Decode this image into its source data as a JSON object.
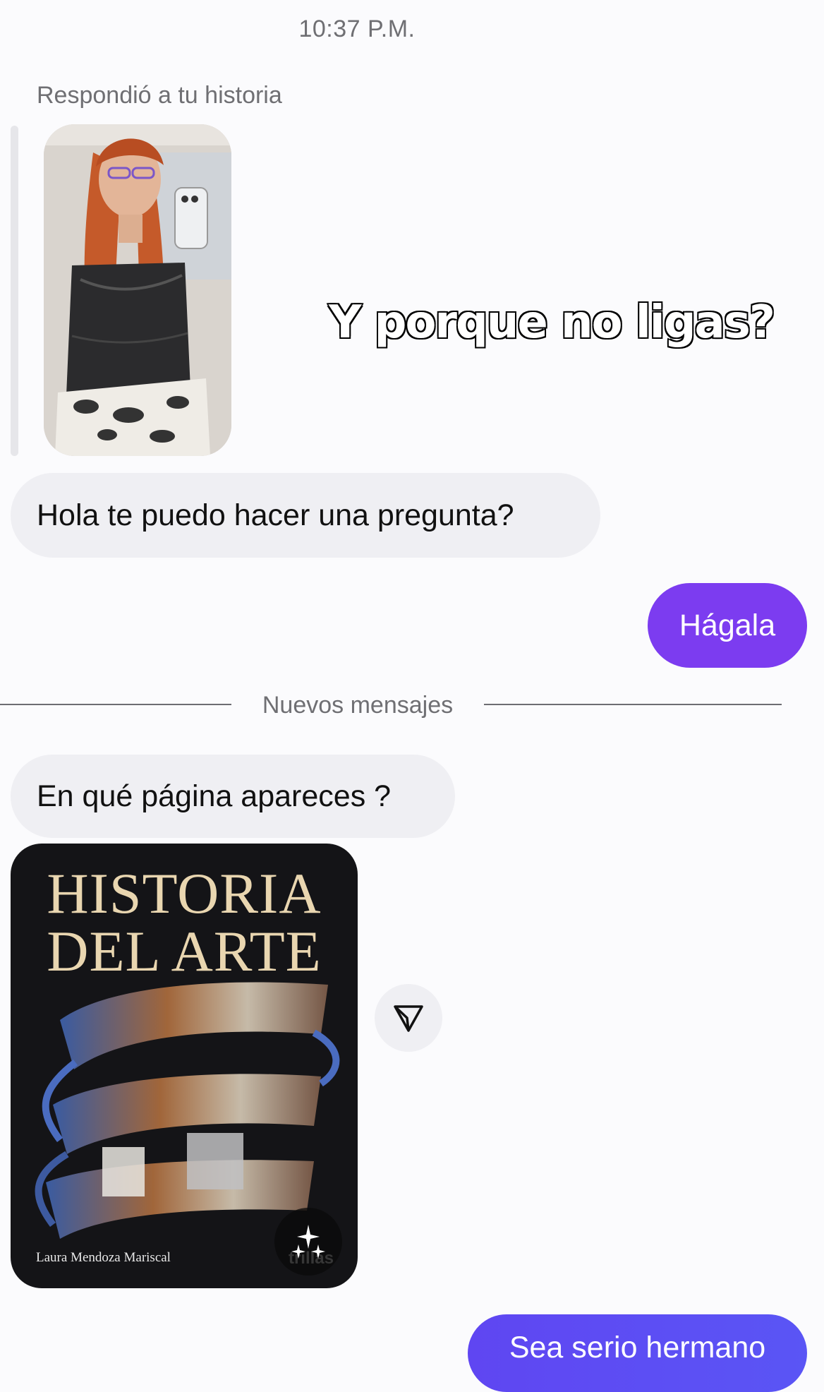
{
  "conversation": {
    "timestamp": "10:37 P.M.",
    "story_reply": {
      "caption": "Respondió a tu historia",
      "overlay_text": "Y porque no ligas?"
    },
    "messages": [
      {
        "id": "m1",
        "direction": "incoming",
        "text": "Hola te puedo hacer una pregunta?"
      },
      {
        "id": "m2",
        "direction": "outgoing",
        "text": "Hágala"
      },
      {
        "id": "m3",
        "direction": "incoming",
        "text": "En qué página apareces ?"
      },
      {
        "id": "m5",
        "direction": "outgoing",
        "text": "Sea serio hermano"
      }
    ],
    "divider": "Nuevos mensajes",
    "attachment": {
      "title_line1": "HISTORIA",
      "title_line2": "DEL ARTE",
      "author": "Laura Mendoza Mariscal",
      "publisher": "trillas"
    }
  },
  "colors": {
    "outgoing_bubble": "#7c3cf0",
    "outgoing_bubble_last": "#5a52f4",
    "incoming_bubble": "#efeff3",
    "muted_text": "#6f6f73",
    "book_title_gold": "#e9d6b0"
  },
  "icons": {
    "share": "paper-plane-icon",
    "ai": "sparkles-icon"
  }
}
